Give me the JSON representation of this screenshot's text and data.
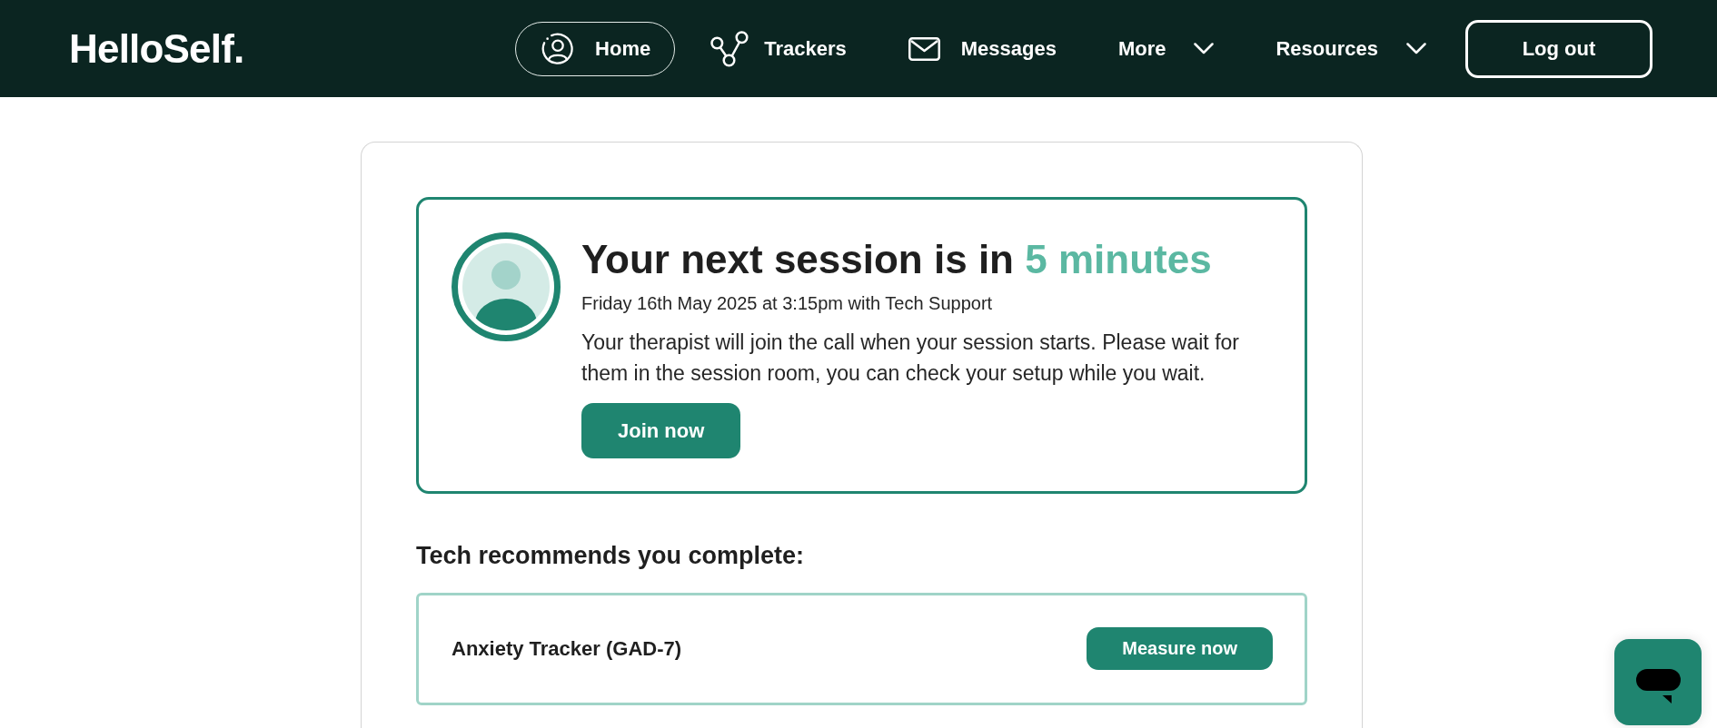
{
  "header": {
    "logo": "HelloSelf.",
    "nav": [
      {
        "kind": "link",
        "label": "Home",
        "selected": true
      },
      {
        "kind": "link",
        "label": "Trackers",
        "selected": false
      },
      {
        "kind": "link",
        "label": "Messages",
        "selected": false
      },
      {
        "kind": "menu",
        "label": "More",
        "selected": false
      },
      {
        "kind": "menu",
        "label": "Resources",
        "selected": false
      }
    ],
    "logout": "Log out"
  },
  "session": {
    "title": "Your next session is in",
    "countdown": "5 minutes",
    "details": "Friday 16th May 2025 at 3:15pm with Tech Support",
    "message": "Your therapist will join the call when your session starts. Please wait for them in the session room, you can check your setup while you wait.",
    "button": "Join now"
  },
  "recommendations": {
    "heading": "Tech recommends you complete:",
    "items": [
      {
        "name": "Anxiety Tracker (GAD-7)",
        "button": "Measure now"
      }
    ]
  }
}
